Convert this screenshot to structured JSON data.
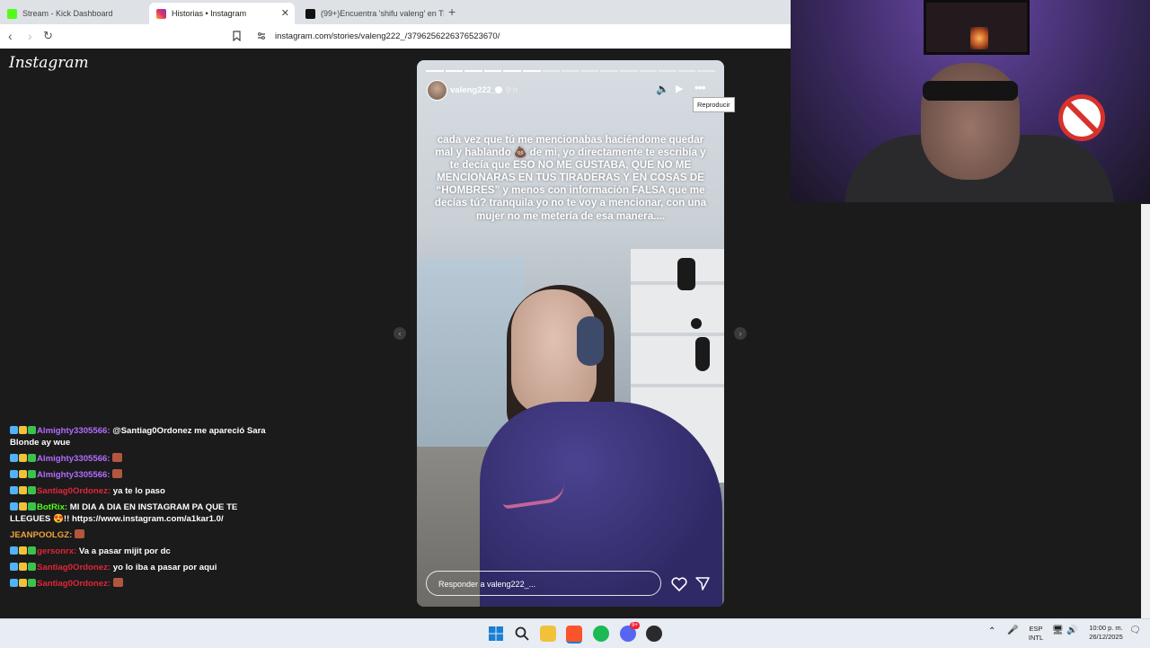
{
  "browser": {
    "tabs": [
      {
        "title": "Stream - Kick Dashboard",
        "favicon_color": "#53fc18"
      },
      {
        "title": "Historias • Instagram",
        "favicon_color": "#e1306c"
      },
      {
        "title": "(99+)Encuentra 'shifu valeng' en TikT",
        "favicon_color": "#111111"
      }
    ],
    "url": "instagram.com/stories/valeng222_/3796256226376523670/"
  },
  "instagram": {
    "logo": "Instagram",
    "story": {
      "username": "valeng222_",
      "time": "9 h",
      "segments_total": 15,
      "segments_done": 6,
      "text": "cada vez que tú me mencionabas haciéndome quedar mal y hablando 💩 de mi, yo directamente te escribía y te decía que ESO NO ME GUSTABA, QUE NO ME MENCIONARAS EN TUS TIRADERAS Y EN COSAS DE “HOMBRES” y menos con información FALSA que me decías tú? tranquila yo no te voy a mencionar, con una mujer no me metería de esa manera....",
      "tooltip": "Reproducir",
      "reply_placeholder": "Responder a valeng222_..."
    }
  },
  "chat": {
    "messages": [
      {
        "user": "Almighty3305566:",
        "color": "#b36bff",
        "text": "@Santiag0Ordonez me apareció Sara Blonde ay wue"
      },
      {
        "user": "Almighty3305566:",
        "color": "#b36bff",
        "text": ""
      },
      {
        "user": "Almighty3305566:",
        "color": "#b36bff",
        "text": ""
      },
      {
        "user": "Santiag0Ordonez:",
        "color": "#e0263a",
        "text": "ya te lo paso"
      },
      {
        "user": "BotRix:",
        "color": "#53fc18",
        "text": "MI DIA A DIA EN INSTAGRAM PA QUE TE LLEGUES 😍!! https://www.instagram.com/a1kar1.0/"
      },
      {
        "user": "JEANPOOLGZ:",
        "color": "#f0a33a",
        "text": ""
      },
      {
        "user": "gersonrx:",
        "color": "#e0263a",
        "text": "Va a pasar mijit por dc"
      },
      {
        "user": "Santiag0Ordonez:",
        "color": "#e0263a",
        "text": "yo lo iba a pasar por aqui"
      },
      {
        "user": "Santiag0Ordonez:",
        "color": "#e0263a",
        "text": ""
      }
    ]
  },
  "taskbar": {
    "lang_top": "ESP",
    "lang_bottom": "INTL",
    "time": "10:00 p. m.",
    "date": "26/12/2025",
    "discord_badge": "9+"
  }
}
